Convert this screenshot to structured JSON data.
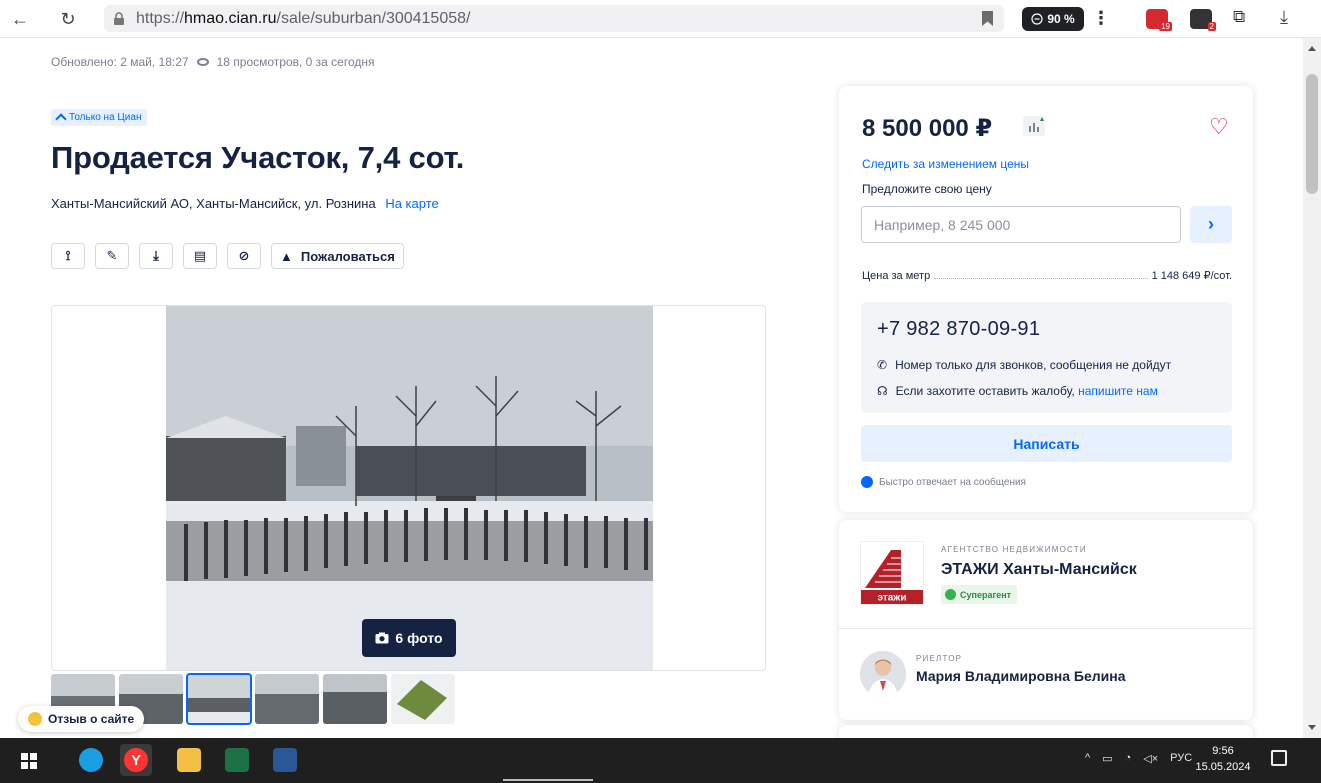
{
  "browser": {
    "url_prefix": "https://",
    "url_domain": "hmao.cian.ru",
    "url_path": "/sale/suburban/300415058/",
    "zoom_label": "90 %",
    "ext_badges": [
      "19",
      "2"
    ]
  },
  "listing": {
    "updated": "Обновлено: 2 май, 18:27",
    "views": "18 просмотров, 0 за сегодня",
    "only_cian": "Только на Циан",
    "title": "Продается Участок, 7,4 сот.",
    "address": "Ханты-Мансийский АО, Ханты-Мансийск, ул. Рознина",
    "map_link": "На карте",
    "report_label": "Пожаловаться",
    "photos_button": "6 фото",
    "feedback_label": "Отзыв о сайте"
  },
  "price_card": {
    "price": "8 500 000 ₽",
    "follow_price": "Следить за изменением цены",
    "suggest_label": "Предложите свою цену",
    "offer_placeholder": "Например, 8 245 000",
    "ppm_label": "Цена за метр",
    "ppm_value": "1 148 649 ₽/сот.",
    "phone": "+7 982 870-09-91",
    "calls_only": "Номер только для звонков, сообщения не дойдут",
    "complaint_text": "Если захотите оставить жалобу,",
    "complaint_link": "напишите нам",
    "write_button": "Написать",
    "fast_reply": "Быстро отвечает на сообщения"
  },
  "agent_card": {
    "agency_type": "АГЕНТСТВО НЕДВИЖИМОСТИ",
    "agency_name": "ЭТАЖИ Ханты-Мансийск",
    "logo_text": "этажи",
    "super_badge": "Суперагент",
    "realtor_type": "РИЕЛТОР",
    "realtor_name": "Мария Владимировна Белина"
  },
  "taskbar": {
    "lang": "РУС",
    "time": "9:56",
    "date": "15.05.2024"
  },
  "colors": {
    "accent": "#0468ff",
    "text": "#152242",
    "heart": "#e3173f",
    "photos_button_bg": "#152242"
  }
}
